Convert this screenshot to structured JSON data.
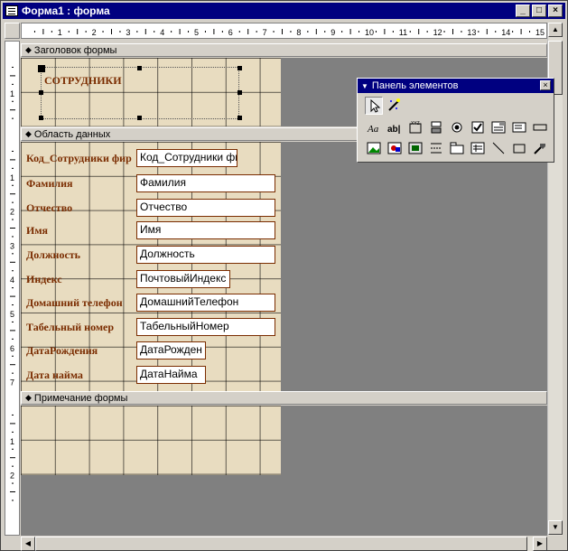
{
  "window": {
    "title": "Форма1 : форма",
    "minimize": "_",
    "maximize": "□",
    "close": "×"
  },
  "ruler": {
    "marks": [
      "1",
      "2",
      "3",
      "4",
      "5",
      "6",
      "7",
      "8",
      "9",
      "10",
      "11",
      "12",
      "13",
      "14",
      "15"
    ]
  },
  "ruler_left": {
    "header_marks": [
      "1"
    ],
    "detail_marks": [
      "1",
      "2",
      "3",
      "4",
      "5",
      "6",
      "7"
    ],
    "footer_marks": [
      "1",
      "2"
    ]
  },
  "sections": {
    "header": "Заголовок формы",
    "detail": "Область данных",
    "footer": "Примечание формы"
  },
  "header_label": "СОТРУДНИКИ",
  "fields": [
    {
      "label": "Код_Сотрудники фир",
      "value": "Код_Сотрудники фи"
    },
    {
      "label": "Фамилия",
      "value": "Фамилия"
    },
    {
      "label": "Отчество",
      "value": "Отчество"
    },
    {
      "label": "Имя",
      "value": "Имя"
    },
    {
      "label": "Должность",
      "value": "Должность"
    },
    {
      "label": "Индекс",
      "value": "ПочтовыйИндекс"
    },
    {
      "label": "Домашний телефон",
      "value": "ДомашнийТелефон"
    },
    {
      "label": "Табельный номер",
      "value": "ТабельныйНомер"
    },
    {
      "label": "ДатаРождения",
      "value": "ДатаРожден"
    },
    {
      "label": "Дата найма",
      "value": "ДатаНайма"
    }
  ],
  "palette": {
    "title": "Панель элементов",
    "close": "×",
    "row1": [
      "select-pointer-icon",
      "control-wizard-icon"
    ],
    "row2": [
      "label-tool-icon",
      "textbox-tool-icon",
      "option-group-icon",
      "toggle-button-icon",
      "option-button-icon",
      "checkbox-icon",
      "combobox-icon",
      "listbox-icon",
      "command-button-icon"
    ],
    "row3": [
      "image-icon",
      "unbound-object-icon",
      "bound-object-icon",
      "page-break-icon",
      "tab-control-icon",
      "subform-icon",
      "line-icon",
      "rectangle-icon",
      "more-controls-icon"
    ],
    "glyphs": {
      "label": "Aa",
      "textbox": "ab|"
    }
  }
}
